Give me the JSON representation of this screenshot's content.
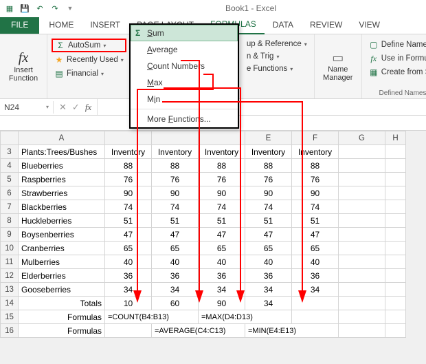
{
  "titlebar": {
    "title": "Book1 - Excel"
  },
  "tabs": {
    "file": "FILE",
    "home": "HOME",
    "insert": "INSERT",
    "pagelayout": "PAGE LAYOUT",
    "formulas": "FORMULAS",
    "data": "DATA",
    "review": "REVIEW",
    "view": "VIEW"
  },
  "ribbon": {
    "insert_function": "Insert\nFunction",
    "autosum": "AutoSum",
    "recently_used": "Recently Used",
    "financial": "Financial",
    "lookup_ref": "up & Reference",
    "math_trig": "n & Trig",
    "more_functions": "e Functions",
    "name_manager": "Name\nManager",
    "define_name": "Define Name",
    "use_in_formula": "Use in Formula",
    "create_from_sel": "Create from Sel",
    "defined_names": "Defined Names"
  },
  "dropdown": {
    "sum": "Sum",
    "average": "Average",
    "count_numbers": "Count Numbers",
    "max": "Max",
    "min": "Min",
    "more": "More Functions..."
  },
  "namebox": {
    "value": "N24"
  },
  "headers": {
    "A": "A",
    "E": "E",
    "F": "F",
    "G": "G",
    "H": "H"
  },
  "row3": {
    "label": "Plants:Trees/Bushes",
    "h": "Inventory"
  },
  "data_rows": [
    {
      "n": 4,
      "name": "Blueberries",
      "v": "88"
    },
    {
      "n": 5,
      "name": "Raspberries",
      "v": "76"
    },
    {
      "n": 6,
      "name": "Strawberries",
      "v": "90"
    },
    {
      "n": 7,
      "name": "Blackberries",
      "v": "74"
    },
    {
      "n": 8,
      "name": "Huckleberries",
      "v": "51"
    },
    {
      "n": 9,
      "name": "Boysenberries",
      "v": "47"
    },
    {
      "n": 10,
      "name": "Cranberries",
      "v": "65"
    },
    {
      "n": 11,
      "name": "Mulberries",
      "v": "40"
    },
    {
      "n": 12,
      "name": "Elderberries",
      "v": "36"
    },
    {
      "n": 13,
      "name": "Gooseberries",
      "v": "34"
    }
  ],
  "totals": {
    "label": "Totals",
    "b": "10",
    "c": "60",
    "d": "90",
    "e": "34"
  },
  "formulas15": {
    "label": "Formulas",
    "b": "=COUNT(B4:B13)",
    "d": "=MAX(D4:D13)"
  },
  "formulas16": {
    "label": "Formulas",
    "c": "=AVERAGE(C4:C13)",
    "e": "=MIN(E4:E13)"
  },
  "chart_data": {
    "type": "table",
    "title": "Plants:Trees/Bushes Inventory",
    "columns": [
      "Plant",
      "Inventory"
    ],
    "rows": [
      [
        "Blueberries",
        88
      ],
      [
        "Raspberries",
        76
      ],
      [
        "Strawberries",
        90
      ],
      [
        "Blackberries",
        74
      ],
      [
        "Huckleberries",
        51
      ],
      [
        "Boysenberries",
        47
      ],
      [
        "Cranberries",
        65
      ],
      [
        "Mulberries",
        40
      ],
      [
        "Elderberries",
        36
      ],
      [
        "Gooseberries",
        34
      ]
    ],
    "aggregates": {
      "COUNT": 10,
      "AVERAGE": 60,
      "MAX": 90,
      "MIN": 34
    }
  }
}
